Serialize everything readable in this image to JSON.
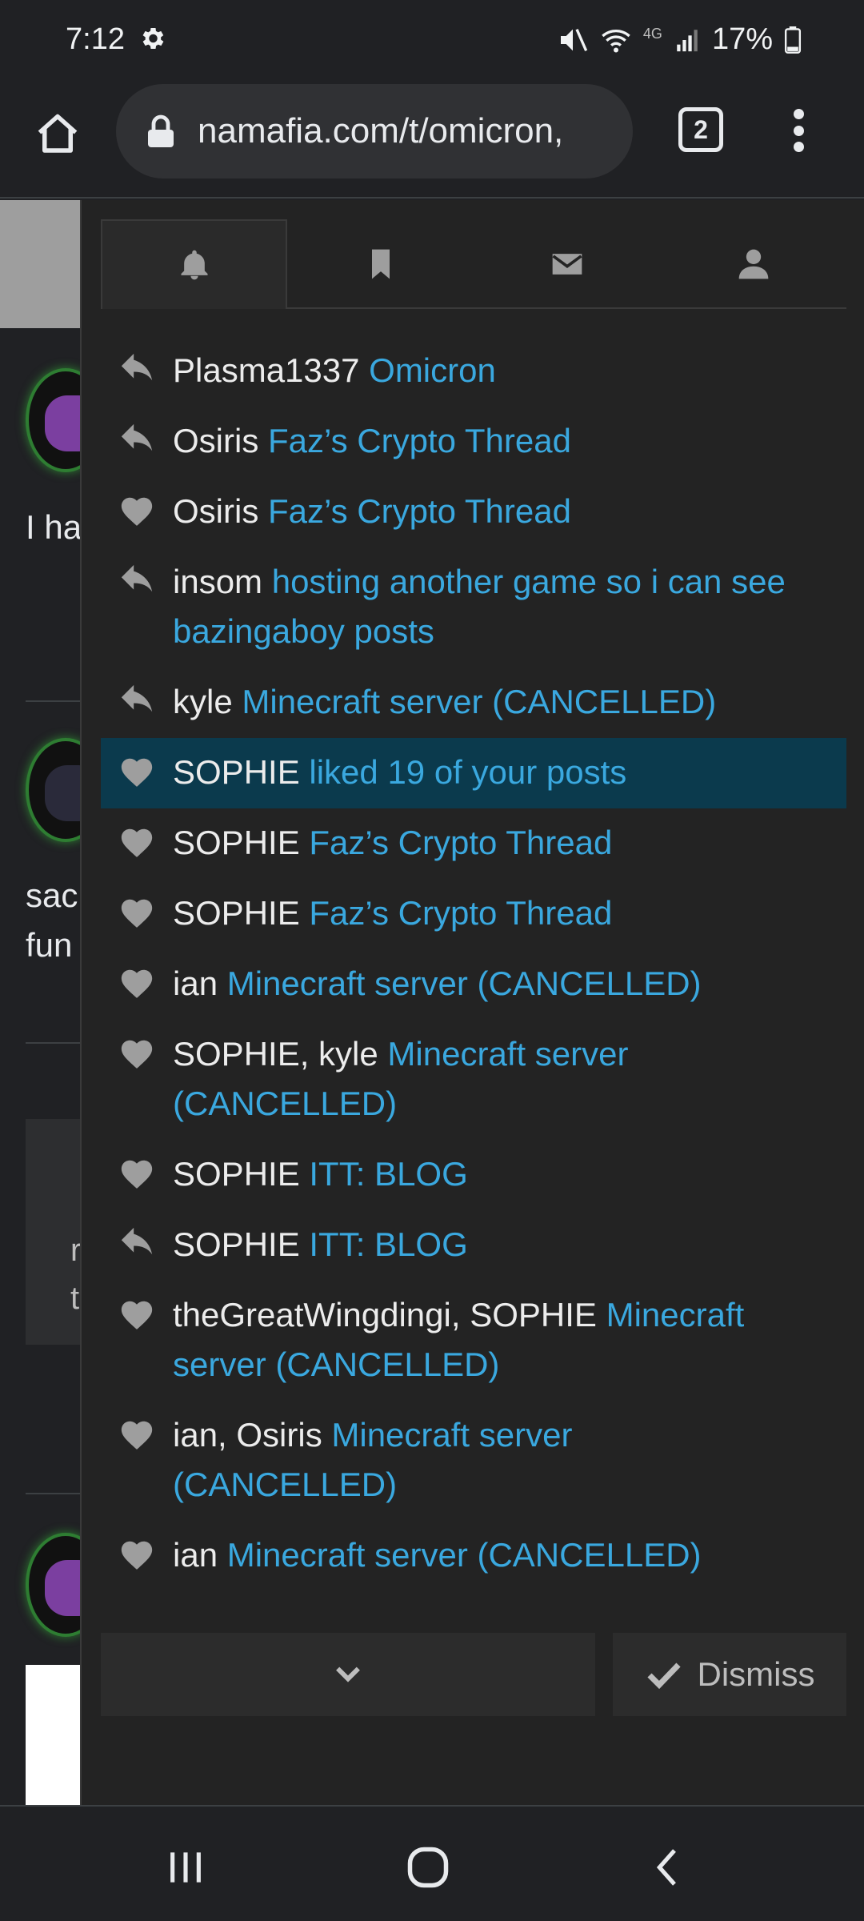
{
  "status_bar": {
    "time": "7:12",
    "battery": "17%",
    "network": "4G"
  },
  "browser": {
    "url": "namafia.com/t/omicron,",
    "tab_count": "2"
  },
  "background_page": {
    "snippet_1": "I ha",
    "snippet_2": "sac",
    "snippet_3": "fun",
    "quote_1": "r",
    "quote_2": "t"
  },
  "panel": {
    "tabs": [
      {
        "name": "alerts",
        "icon": "bell-icon",
        "active": true
      },
      {
        "name": "bookmarks",
        "icon": "bookmark-icon",
        "active": false
      },
      {
        "name": "messages",
        "icon": "envelope-icon",
        "active": false
      },
      {
        "name": "profile",
        "icon": "user-icon",
        "active": false
      }
    ],
    "notifications": [
      {
        "type": "reply",
        "icon": "reply-icon",
        "user": "Plasma1337",
        "link": "Omicron"
      },
      {
        "type": "reply",
        "icon": "reply-icon",
        "user": "Osiris",
        "link": "Faz’s Crypto Thread"
      },
      {
        "type": "like",
        "icon": "heart-icon",
        "user": "Osiris",
        "link": "Faz’s Crypto Thread"
      },
      {
        "type": "reply",
        "icon": "reply-icon",
        "user": "insom",
        "link": "hosting another game so i can see bazingaboy posts"
      },
      {
        "type": "reply",
        "icon": "reply-icon",
        "user": "kyle",
        "link": "Minecraft server (CANCELLED)"
      },
      {
        "type": "like",
        "icon": "heart-icon",
        "user": "SOPHIE",
        "link": "liked 19 of your posts",
        "highlighted": true
      },
      {
        "type": "like",
        "icon": "heart-icon",
        "user": "SOPHIE",
        "link": "Faz’s Crypto Thread"
      },
      {
        "type": "like",
        "icon": "heart-icon",
        "user": "SOPHIE",
        "link": "Faz’s Crypto Thread"
      },
      {
        "type": "like",
        "icon": "heart-icon",
        "user": "ian",
        "link": "Minecraft server (CANCELLED)"
      },
      {
        "type": "like",
        "icon": "heart-icon",
        "user": "SOPHIE, kyle",
        "link": "Minecraft server (CANCELLED)"
      },
      {
        "type": "like",
        "icon": "heart-icon",
        "user": "SOPHIE",
        "link": "ITT: BLOG"
      },
      {
        "type": "reply",
        "icon": "reply-icon",
        "user": "SOPHIE",
        "link": "ITT: BLOG"
      },
      {
        "type": "like",
        "icon": "heart-icon",
        "user": "theGreatWingdingi, SOPHIE",
        "link": "Minecraft server (CANCELLED)"
      },
      {
        "type": "like",
        "icon": "heart-icon",
        "user": "ian, Osiris",
        "link": "Minecraft server (CANCELLED)"
      },
      {
        "type": "like",
        "icon": "heart-icon",
        "user": "ian",
        "link": "Minecraft server (CANCELLED)"
      }
    ],
    "dismiss_label": "Dismiss"
  },
  "colors": {
    "link": "#3aa8df",
    "highlight": "#0b3a4d",
    "panel_bg": "#232323"
  }
}
